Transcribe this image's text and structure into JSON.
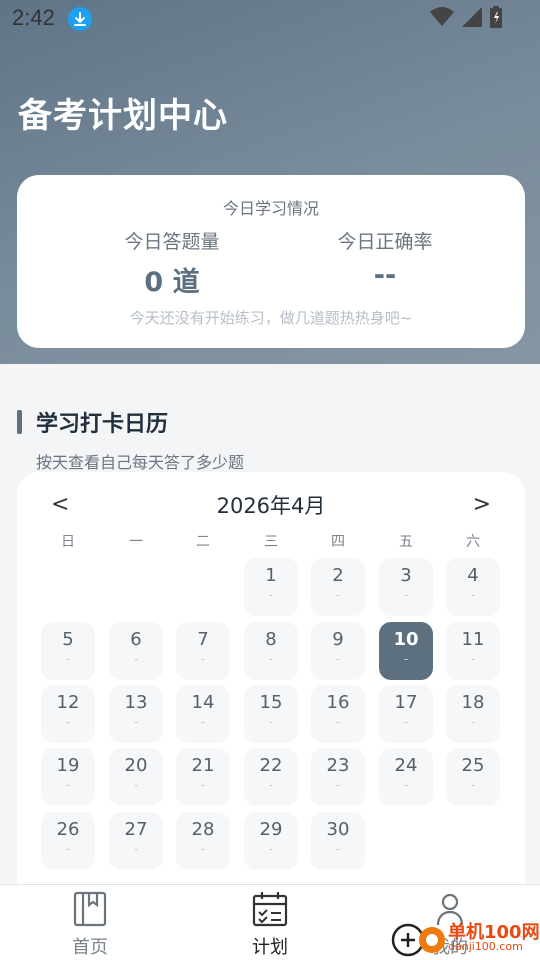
{
  "status_bar": {
    "time": "2:42"
  },
  "header": {
    "title": "备考计划中心"
  },
  "today_card": {
    "title": "今日学习情况",
    "answered_label": "今日答题量",
    "answered_value": "0 道",
    "accuracy_label": "今日正确率",
    "accuracy_value": "--",
    "hint": "今天还没有开始练习，做几道题热热身吧~"
  },
  "calendar_section": {
    "title": "学习打卡日历",
    "subtitle": "按天查看自己每天答了多少题"
  },
  "calendar": {
    "prev": "<",
    "next": ">",
    "month": "2026年4月",
    "weekdays": [
      "日",
      "一",
      "二",
      "三",
      "四",
      "五",
      "六"
    ],
    "first_weekday_index": 3,
    "days_in_month": 30,
    "selected_day": 10,
    "day_placeholder": "-",
    "accent": "#5c7080"
  },
  "tabbar": {
    "home": "首页",
    "plan": "计划",
    "mine": "我的"
  },
  "watermark": {
    "text": "单机100网",
    "url": "danji100.com"
  }
}
